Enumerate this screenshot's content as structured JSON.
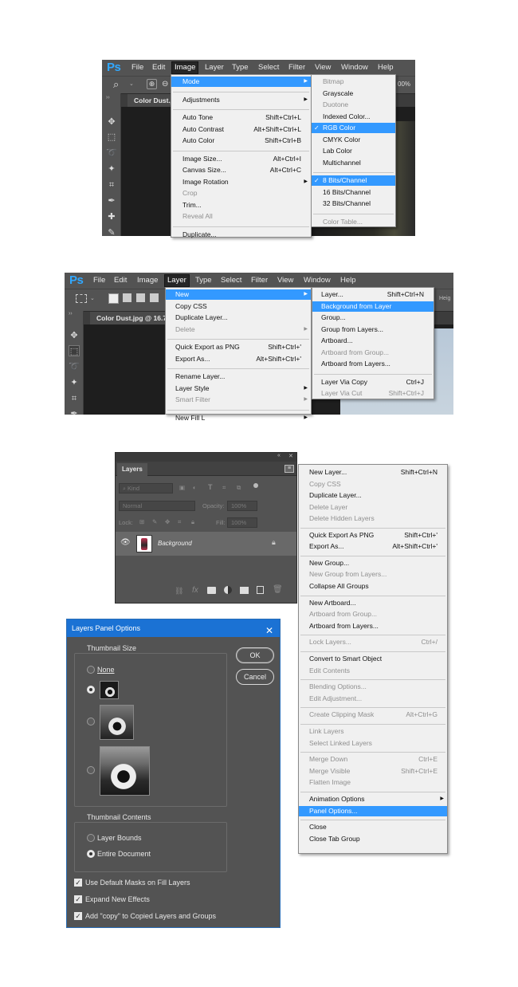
{
  "screen1": {
    "logo": "Ps",
    "menubar": [
      "File",
      "Edit",
      "Image",
      "Layer",
      "Type",
      "Select",
      "Filter",
      "View",
      "Window",
      "Help"
    ],
    "active_menu": "Image",
    "zoom": "00%",
    "doc_tab": "Color Dust.jp",
    "image_menu": [
      {
        "label": "Mode",
        "shortcut": "",
        "submenu": true,
        "highlighted": true
      },
      {
        "sep": true
      },
      {
        "label": "Adjustments",
        "shortcut": "",
        "submenu": true
      },
      {
        "sep": true
      },
      {
        "label": "Auto Tone",
        "shortcut": "Shift+Ctrl+L"
      },
      {
        "label": "Auto Contrast",
        "shortcut": "Alt+Shift+Ctrl+L"
      },
      {
        "label": "Auto Color",
        "shortcut": "Shift+Ctrl+B"
      },
      {
        "sep": true
      },
      {
        "label": "Image Size...",
        "shortcut": "Alt+Ctrl+I"
      },
      {
        "label": "Canvas Size...",
        "shortcut": "Alt+Ctrl+C"
      },
      {
        "label": "Image Rotation",
        "shortcut": "",
        "submenu": true
      },
      {
        "label": "Crop",
        "shortcut": "",
        "disabled": true
      },
      {
        "label": "Trim...",
        "shortcut": ""
      },
      {
        "label": "Reveal All",
        "shortcut": "",
        "disabled": true
      },
      {
        "sep": true
      },
      {
        "label": "Duplicate...",
        "shortcut": ""
      }
    ],
    "mode_submenu": [
      {
        "label": "Bitmap",
        "disabled": true
      },
      {
        "label": "Grayscale"
      },
      {
        "label": "Duotone",
        "disabled": true
      },
      {
        "label": "Indexed Color..."
      },
      {
        "label": "RGB Color",
        "checked": true,
        "highlighted": true
      },
      {
        "label": "CMYK Color"
      },
      {
        "label": "Lab Color"
      },
      {
        "label": "Multichannel"
      },
      {
        "sep": true
      },
      {
        "label": "8 Bits/Channel",
        "checked": true,
        "highlighted": true
      },
      {
        "label": "16 Bits/Channel"
      },
      {
        "label": "32 Bits/Channel"
      },
      {
        "sep": true
      },
      {
        "label": "Color Table...",
        "disabled": true
      }
    ]
  },
  "screen2": {
    "logo": "Ps",
    "menubar": [
      "File",
      "Edit",
      "Image",
      "Layer",
      "Type",
      "Select",
      "Filter",
      "View",
      "Window",
      "Help"
    ],
    "active_menu": "Layer",
    "doc_tab": "Color Dust.jpg @ 16.7",
    "right_opt": "Heig",
    "layer_menu": [
      {
        "label": "New",
        "submenu": true,
        "highlighted": true
      },
      {
        "label": "Copy CSS"
      },
      {
        "label": "Duplicate Layer..."
      },
      {
        "label": "Delete",
        "submenu": true,
        "disabled": true
      },
      {
        "sep": true
      },
      {
        "label": "Quick Export as PNG",
        "shortcut": "Shift+Ctrl+'"
      },
      {
        "label": "Export As...",
        "shortcut": "Alt+Shift+Ctrl+'"
      },
      {
        "sep": true
      },
      {
        "label": "Rename Layer..."
      },
      {
        "label": "Layer Style",
        "submenu": true
      },
      {
        "label": "Smart Filter",
        "submenu": true,
        "disabled": true
      },
      {
        "sep": true
      },
      {
        "label": "New Fill L",
        "submenu": true
      }
    ],
    "new_submenu": [
      {
        "label": "Layer...",
        "shortcut": "Shift+Ctrl+N"
      },
      {
        "label": "Background from Layer",
        "highlighted": true
      },
      {
        "label": "Group..."
      },
      {
        "label": "Group from Layers..."
      },
      {
        "label": "Artboard..."
      },
      {
        "label": "Artboard from Group...",
        "disabled": true
      },
      {
        "label": "Artboard from Layers..."
      },
      {
        "sep": true
      },
      {
        "label": "Layer Via Copy",
        "shortcut": "Ctrl+J"
      },
      {
        "label": "Layer Via Cut",
        "shortcut": "Shift+Ctrl+J",
        "disabled": true
      }
    ]
  },
  "layers_panel": {
    "collapse": "«",
    "close": "✕",
    "tab": "Layers",
    "kind": "Kind",
    "blend": "Normal",
    "opacity_label": "Opacity:",
    "opacity_value": "100%",
    "lock_label": "Lock:",
    "fill_label": "Fill:",
    "fill_value": "100%",
    "layer_name": "Background"
  },
  "panel_menu": [
    {
      "label": "New Layer...",
      "shortcut": "Shift+Ctrl+N"
    },
    {
      "label": "Copy CSS",
      "disabled": true
    },
    {
      "label": "Duplicate Layer..."
    },
    {
      "label": "Delete Layer",
      "disabled": true
    },
    {
      "label": "Delete Hidden Layers",
      "disabled": true
    },
    {
      "sep": true
    },
    {
      "label": "Quick Export As PNG",
      "shortcut": "Shift+Ctrl+'"
    },
    {
      "label": "Export As...",
      "shortcut": "Alt+Shift+Ctrl+'"
    },
    {
      "sep": true
    },
    {
      "label": "New Group..."
    },
    {
      "label": "New Group from Layers...",
      "disabled": true
    },
    {
      "label": "Collapse All Groups"
    },
    {
      "sep": true
    },
    {
      "label": "New Artboard..."
    },
    {
      "label": "Artboard from Group...",
      "disabled": true
    },
    {
      "label": "Artboard from Layers..."
    },
    {
      "sep": true
    },
    {
      "label": "Lock Layers...",
      "shortcut": "Ctrl+/",
      "disabled": true
    },
    {
      "sep": true
    },
    {
      "label": "Convert to Smart Object"
    },
    {
      "label": "Edit Contents",
      "disabled": true
    },
    {
      "sep": true
    },
    {
      "label": "Blending Options...",
      "disabled": true
    },
    {
      "label": "Edit Adjustment...",
      "disabled": true
    },
    {
      "sep": true
    },
    {
      "label": "Create Clipping Mask",
      "shortcut": "Alt+Ctrl+G",
      "disabled": true
    },
    {
      "sep": true
    },
    {
      "label": "Link Layers",
      "disabled": true
    },
    {
      "label": "Select Linked Layers",
      "disabled": true
    },
    {
      "sep": true
    },
    {
      "label": "Merge Down",
      "shortcut": "Ctrl+E",
      "disabled": true
    },
    {
      "label": "Merge Visible",
      "shortcut": "Shift+Ctrl+E",
      "disabled": true
    },
    {
      "label": "Flatten Image",
      "disabled": true
    },
    {
      "sep": true
    },
    {
      "label": "Animation Options",
      "submenu": true
    },
    {
      "label": "Panel Options...",
      "highlighted": true
    },
    {
      "sep": true
    },
    {
      "label": "Close"
    },
    {
      "label": "Close Tab Group"
    }
  ],
  "dialog": {
    "title": "Layers Panel Options",
    "close": "✕",
    "thumb_size_title": "Thumbnail Size",
    "none_label": "None",
    "thumb_contents_title": "Thumbnail Contents",
    "layer_bounds": "Layer Bounds",
    "entire_document": "Entire Document",
    "ok": "OK",
    "cancel": "Cancel",
    "opt1": "Use Default Masks on Fill Layers",
    "opt2": "Expand New Effects",
    "opt3": "Add \"copy\" to Copied Layers and Groups",
    "selected_thumb_size": "small",
    "selected_contents": "Entire Document"
  },
  "colors": {
    "highlight": "#3399ff",
    "ps_blue": "#31a8ff",
    "dialog_title": "#1b72d4"
  }
}
